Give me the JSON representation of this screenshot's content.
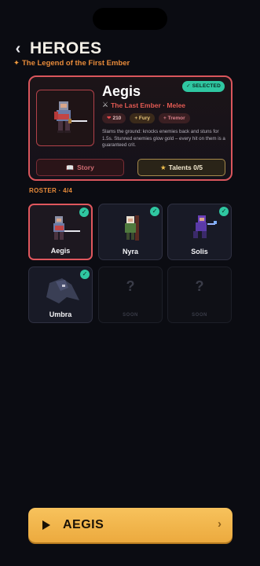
{
  "header": {
    "back_icon": "chevron-left-icon",
    "title": "HEROES",
    "subtitle": "The Legend of the First Ember"
  },
  "hero": {
    "name": "Aegis",
    "badge": "✓ SELECTED",
    "class_label": "The Last Ember · Melee",
    "hp": "210",
    "trait_1": "+ Fury",
    "trait_2": "+ Tremor",
    "description": "Slams the ground: knocks enemies back and stuns for 1.5s. Stunned enemies glow gold – every hit on them is a guaranteed crit.",
    "story_label": "Story",
    "talents_label": "Talents 0/5"
  },
  "roster": {
    "label": "ROSTER · 4/4",
    "slots": [
      {
        "name": "Aegis",
        "selected": true,
        "unlocked": true
      },
      {
        "name": "Nyra",
        "unlocked": true
      },
      {
        "name": "Solis",
        "unlocked": true
      },
      {
        "name": "Umbra",
        "unlocked": true
      },
      {
        "q": "?",
        "soon": "SOON"
      },
      {
        "q": "?",
        "soon": "SOON"
      }
    ]
  },
  "cta": {
    "label": "AEGIS"
  },
  "colors": {
    "accent": "#e88b3a",
    "selected_border": "#e0575d",
    "check": "#2fc7a1",
    "cta": "#f2b64a"
  }
}
